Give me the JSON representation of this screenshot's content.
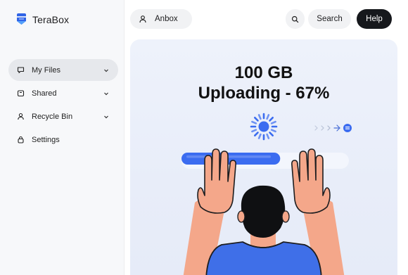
{
  "app": {
    "name": "TeraBox"
  },
  "sidebar": {
    "items": [
      {
        "label": "My Files",
        "icon": "folder-icon",
        "active": true,
        "expandable": true
      },
      {
        "label": "Shared",
        "icon": "share-icon",
        "active": false,
        "expandable": true
      },
      {
        "label": "Recycle Bin",
        "icon": "user-icon",
        "active": false,
        "expandable": true
      },
      {
        "label": "Settings",
        "icon": "lock-icon",
        "active": false,
        "expandable": false
      }
    ]
  },
  "header": {
    "search_value": "Anbox",
    "search_button": "Search",
    "help_button": "Help"
  },
  "hero": {
    "line1": "100 GB",
    "line2": "Uploading - 67%",
    "progress": 0.67
  },
  "colors": {
    "accent": "#3b6cf0",
    "dark": "#16181c",
    "skin": "#f4a78a",
    "shirt": "#3f6fe8"
  }
}
